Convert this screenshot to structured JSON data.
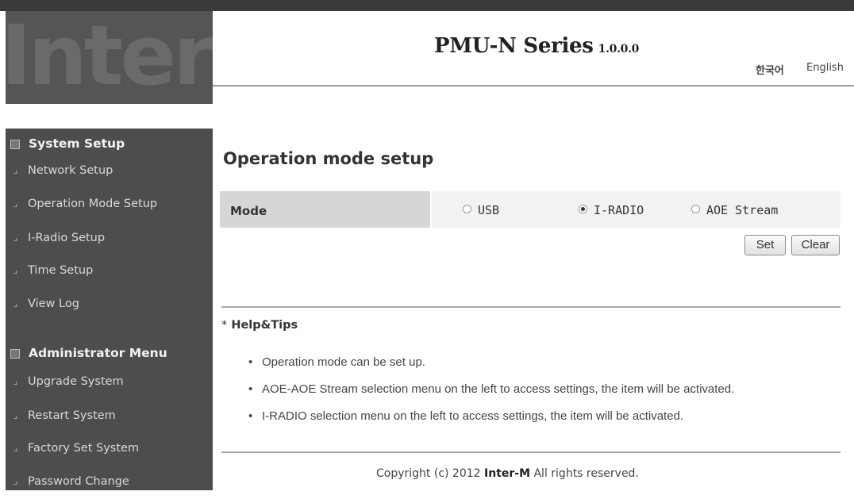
{
  "brand": {
    "logo_text": "InterM"
  },
  "header": {
    "title": "PMU-N Series",
    "version": "1.0.0.0",
    "lang_korean": "한국어",
    "lang_english": "English"
  },
  "sidebar": {
    "sections": [
      {
        "label": "System Setup",
        "items": [
          "Network Setup",
          "Operation Mode Setup",
          "I-Radio Setup",
          "Time Setup",
          "View Log"
        ]
      },
      {
        "label": "Administrator Menu",
        "items": [
          "Upgrade System",
          "Restart System",
          "Factory Set System",
          "Password Change"
        ]
      }
    ]
  },
  "main": {
    "page_title": "Operation mode setup",
    "mode_label": "Mode",
    "options": [
      {
        "label": "USB",
        "selected": false
      },
      {
        "label": "I-RADIO",
        "selected": true
      },
      {
        "label": "AOE Stream",
        "selected": false
      }
    ],
    "set_label": "Set",
    "clear_label": "Clear",
    "help_star": "*",
    "help_title": "Help&Tips",
    "bullet": "•",
    "tips": [
      "Operation mode can be set up.",
      "AOE-AOE Stream selection menu on the left to access settings, the item will be activated.",
      "I-RADIO selection menu on the left to access settings, the item will be activated."
    ]
  },
  "footer": {
    "prefix": "Copyright (c) 2012",
    "company": "Inter-M",
    "suffix": "All rights reserved."
  },
  "icons": {
    "section": "section-square-icon",
    "item": "corner-arrow-icon",
    "item_glyph": "⌟"
  }
}
